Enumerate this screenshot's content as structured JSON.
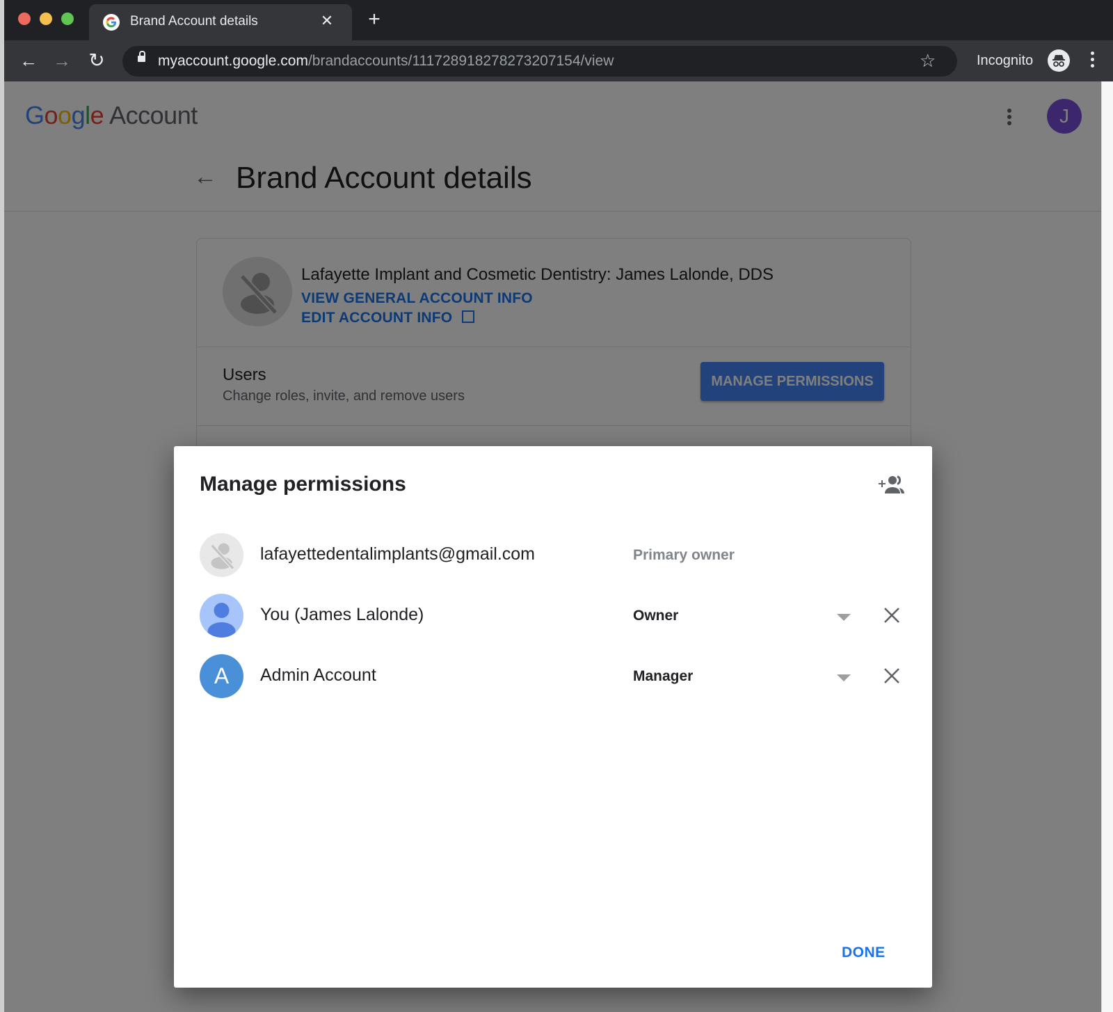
{
  "browser": {
    "tab_title": "Brand Account details",
    "url_host": "myaccount.google.com",
    "url_path": "/brandaccounts/111728918278273207154/view",
    "incognito_label": "Incognito",
    "icons": {
      "back": "arrow-left-icon",
      "forward": "arrow-right-icon",
      "reload": "reload-icon",
      "lock": "lock-icon",
      "bookmark": "star-icon",
      "incognito": "incognito-icon",
      "menu": "kebab-menu-icon",
      "tab_close": "close-icon",
      "new_tab": "plus-icon"
    }
  },
  "header": {
    "logo_google": "Google",
    "logo_account": "Account",
    "avatar_initial": "J",
    "avatar_color": "#7b4fd8"
  },
  "page": {
    "title": "Brand Account details",
    "brand": {
      "name": "Lafayette Implant and Cosmetic Dentistry: James Lalonde, DDS",
      "view_link": "VIEW GENERAL ACCOUNT INFO",
      "edit_link": "EDIT ACCOUNT INFO"
    },
    "users": {
      "title": "Users",
      "subtitle": "Change roles, invite, and remove users",
      "button": "MANAGE PERMISSIONS"
    }
  },
  "dialog": {
    "title": "Manage permissions",
    "add_icon": "add-people-icon",
    "rows": [
      {
        "name": "lafayettedentalimplants@gmail.com",
        "role": "Primary owner",
        "editable": false,
        "avatar": "no-photo-icon"
      },
      {
        "name": "You (James Lalonde)",
        "role": "Owner",
        "editable": true,
        "avatar": "person-icon"
      },
      {
        "name": "Admin Account",
        "role": "Manager",
        "editable": true,
        "avatar": "A",
        "avatar_color": "#4a90d9"
      }
    ],
    "done": "DONE"
  },
  "colors": {
    "accent": "#1a73e8",
    "chrome_dark": "#202124",
    "chrome_toolbar": "#35363a"
  }
}
